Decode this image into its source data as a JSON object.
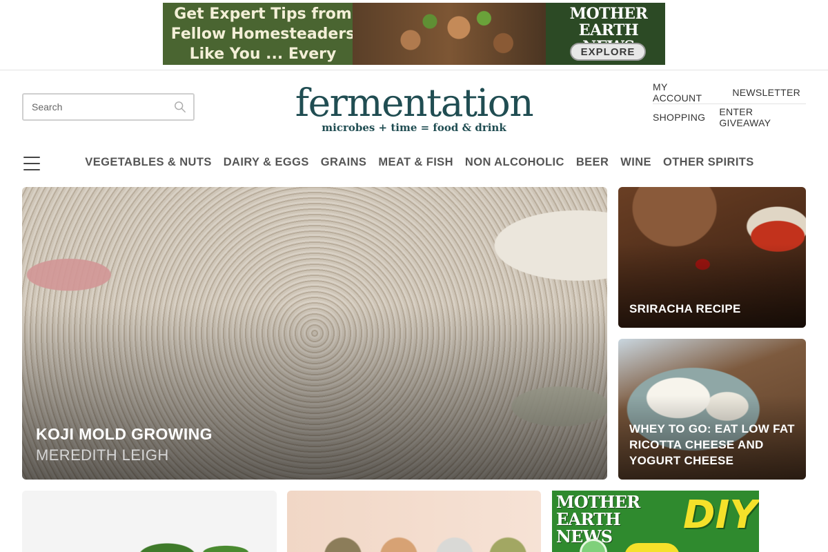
{
  "ad_banner": {
    "headline": "Get Expert Tips from Fellow Homesteaders Like You ... Every Week",
    "brand": "MOTHER EARTH NEWS",
    "cta": "EXPLORE"
  },
  "header": {
    "search_placeholder": "Search",
    "logo_title": "fermentation",
    "logo_tagline": "microbes + time = food & drink",
    "links_row1": [
      "MY ACCOUNT",
      "NEWSLETTER"
    ],
    "links_row2": [
      "SHOPPING",
      "ENTER GIVEAWAY"
    ]
  },
  "nav": {
    "items": [
      "VEGETABLES & NUTS",
      "DAIRY & EGGS",
      "GRAINS",
      "MEAT & FISH",
      "NON ALCOHOLIC",
      "BEER",
      "WINE",
      "OTHER SPIRITS"
    ]
  },
  "featured": {
    "title": "KOJI MOLD GROWING",
    "author": "MEREDITH LEIGH"
  },
  "side_cards": [
    {
      "title": "SRIRACHA RECIPE"
    },
    {
      "title": "WHEY TO GO: EAT LOW FAT RICOTTA CHEESE AND YOGURT CHEESE"
    }
  ],
  "bottom_ad": {
    "brand": "MOTHER EARTH NEWS",
    "tag": "DIY"
  }
}
